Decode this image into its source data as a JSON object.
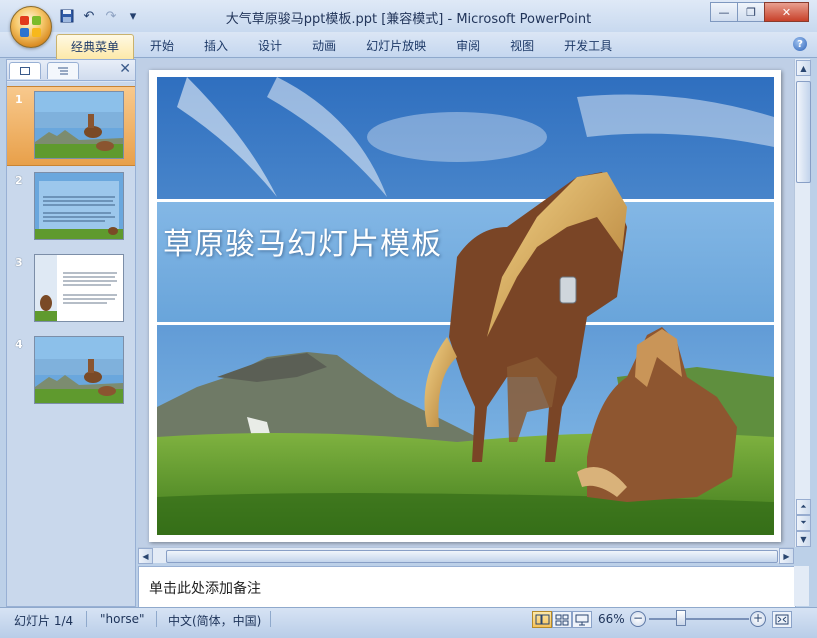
{
  "window": {
    "title": "大气草原骏马ppt模板.ppt [兼容模式] - Microsoft PowerPoint",
    "controls": {
      "minimize": "—",
      "restore": "❐",
      "close": "✕"
    }
  },
  "qat": {
    "save_icon": "save-icon",
    "undo": "↶",
    "redo": "↷",
    "dropdown": "▾"
  },
  "ribbon": {
    "tabs": [
      {
        "label": "经典菜单"
      },
      {
        "label": "开始"
      },
      {
        "label": "插入"
      },
      {
        "label": "设计"
      },
      {
        "label": "动画"
      },
      {
        "label": "幻灯片放映"
      },
      {
        "label": "审阅"
      },
      {
        "label": "视图"
      },
      {
        "label": "开发工具"
      }
    ],
    "help": "?"
  },
  "left_pane": {
    "close": "✕",
    "thumbnails": [
      {
        "number": "1"
      },
      {
        "number": "2"
      },
      {
        "number": "3"
      },
      {
        "number": "4"
      }
    ]
  },
  "slide": {
    "title": "草原骏马幻灯片模板"
  },
  "notes": {
    "placeholder": "单击此处添加备注"
  },
  "status": {
    "slide_info": "幻灯片 1/4",
    "theme": "\"horse\"",
    "language": "中文(简体，中国)",
    "zoom": "66%",
    "zoom_minus": "−",
    "zoom_plus": "+"
  },
  "colors": {
    "accent": "#e8a04a",
    "ribbon": "#c5d7ef",
    "sky": "#5a9fd8",
    "grass": "#5f9a2e"
  }
}
